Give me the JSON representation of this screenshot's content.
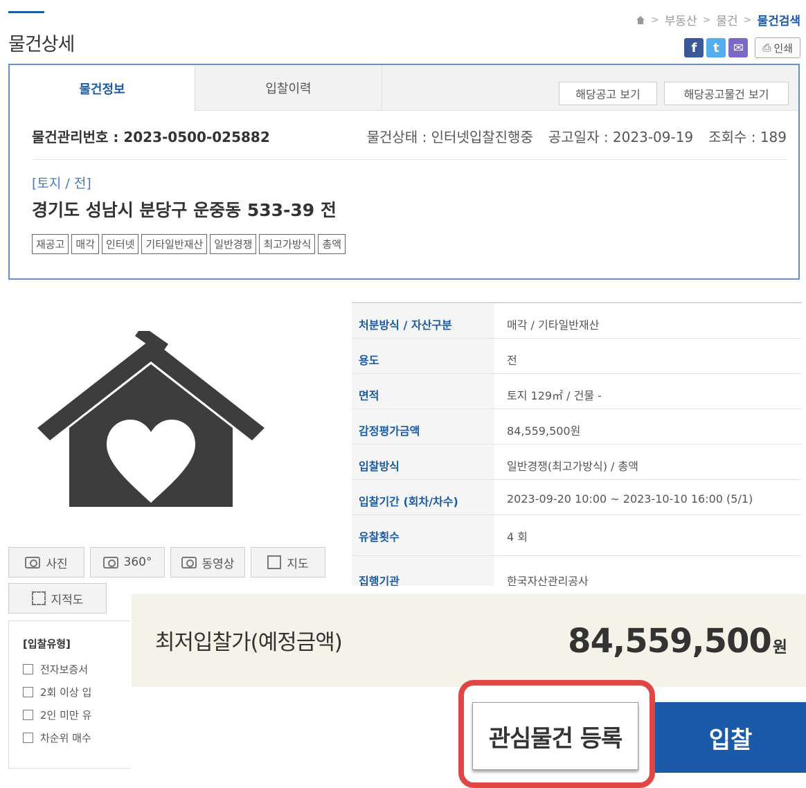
{
  "page": {
    "title": "물건상세"
  },
  "breadcrumb": {
    "items": [
      "부동산",
      "물건"
    ],
    "current": "물건검색"
  },
  "share": {
    "facebook": "f",
    "twitter": "t",
    "mail": "✉",
    "print": "인쇄"
  },
  "tabs": [
    {
      "label": "물건정보"
    },
    {
      "label": "입찰이력"
    }
  ],
  "tab_buttons": {
    "notice": "해당공고 보기",
    "notice_items": "해당공고물건 보기"
  },
  "item": {
    "management_no": "물건관리번호 : 2023-0500-025882",
    "status": "물건상태 : 인터넷입찰진행중",
    "notice_date": "공고일자 : 2023-09-19",
    "views": "조회수 : 189",
    "category": "[토지 / 전]",
    "address": "경기도 성남시 분당구 운중동 533-39 전",
    "tags": [
      "재공고",
      "매각",
      "인터넷",
      "기타일반재산",
      "일반경쟁",
      "최고가방식",
      "총액"
    ]
  },
  "media": {
    "photo": "사진",
    "vr360": "360°",
    "video": "동영상",
    "map": "지도",
    "cadastral": "지적도"
  },
  "bid_types": {
    "title": "[입찰유형]",
    "items": [
      "전자보증서",
      "2회 이상 입",
      "2인 미만 유",
      "차순위 매수"
    ]
  },
  "details": [
    {
      "label": "처분방식 / 자산구분",
      "value": "매각 / 기타일반재산"
    },
    {
      "label": "용도",
      "value": "전"
    },
    {
      "label": "면적",
      "value": "토지 129㎡ / 건물 -"
    },
    {
      "label": "감정평가금액",
      "value": "84,559,500원"
    },
    {
      "label": "입찰방식",
      "value": "일반경쟁(최고가방식) / 총액"
    },
    {
      "label": "입찰기간 (회차/차수)",
      "value": "2023-09-20 10:00 ~ 2023-10-10 16:00 (5/1)"
    },
    {
      "label": "유찰횟수",
      "value": "4 회"
    },
    {
      "label": "집행기관",
      "value": "한국자산관리공사"
    }
  ],
  "price": {
    "label": "최저입찰가(예정금액)",
    "value": "84,559,500",
    "unit": "원"
  },
  "actions": {
    "favorite": "관심물건 등록",
    "bid": "입찰"
  },
  "colors": {
    "accent": "#1b5aa8",
    "highlight": "#e14646",
    "price_panel": "#f5f2e7"
  }
}
